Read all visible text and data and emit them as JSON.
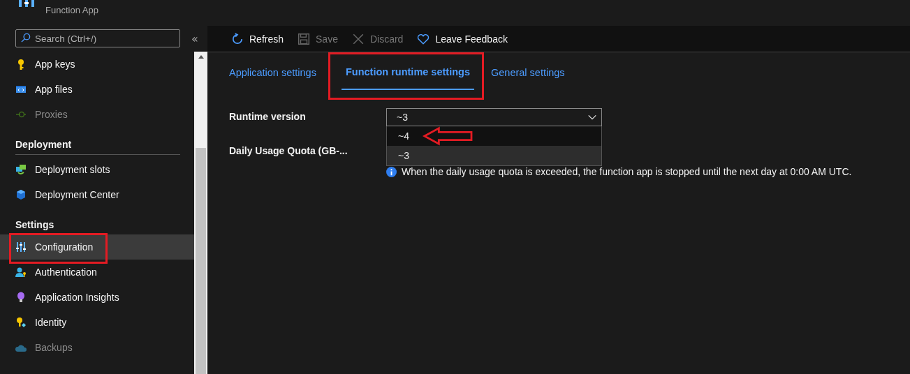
{
  "header": {
    "subtitle": "Function App"
  },
  "sidebar": {
    "search": {
      "placeholder": "Search (Ctrl+/)"
    },
    "collapse": "«",
    "items": [
      {
        "kind": "item",
        "label": "App keys",
        "disabled": false,
        "selected": false,
        "highlighted": false
      },
      {
        "kind": "item",
        "label": "App files",
        "disabled": false,
        "selected": false,
        "highlighted": false
      },
      {
        "kind": "item",
        "label": "Proxies",
        "disabled": true,
        "selected": false,
        "highlighted": false
      },
      {
        "kind": "section",
        "label": "Deployment"
      },
      {
        "kind": "item",
        "label": "Deployment slots",
        "disabled": false,
        "selected": false,
        "highlighted": false
      },
      {
        "kind": "item",
        "label": "Deployment Center",
        "disabled": false,
        "selected": false,
        "highlighted": false
      },
      {
        "kind": "section",
        "label": "Settings"
      },
      {
        "kind": "item",
        "label": "Configuration",
        "disabled": false,
        "selected": true,
        "highlighted": true
      },
      {
        "kind": "item",
        "label": "Authentication",
        "disabled": false,
        "selected": false,
        "highlighted": false
      },
      {
        "kind": "item",
        "label": "Application Insights",
        "disabled": false,
        "selected": false,
        "highlighted": false
      },
      {
        "kind": "item",
        "label": "Identity",
        "disabled": false,
        "selected": false,
        "highlighted": false
      },
      {
        "kind": "item",
        "label": "Backups",
        "disabled": true,
        "selected": false,
        "highlighted": false
      }
    ]
  },
  "toolbar": [
    {
      "label": "Refresh",
      "disabled": false
    },
    {
      "label": "Save",
      "disabled": true
    },
    {
      "label": "Discard",
      "disabled": true
    },
    {
      "label": "Leave Feedback",
      "disabled": false
    }
  ],
  "tabs": [
    {
      "label": "Application settings",
      "selected": false,
      "highlighted": false
    },
    {
      "label": "Function runtime settings",
      "selected": true,
      "highlighted": true
    },
    {
      "label": "General settings",
      "selected": false,
      "highlighted": false
    }
  ],
  "form": {
    "runtime_label": "Runtime version",
    "runtime_value": "~3",
    "options": [
      {
        "label": "~4",
        "selected": false,
        "pointed": true
      },
      {
        "label": "~3",
        "selected": true,
        "pointed": false
      }
    ],
    "quota_label": "Daily Usage Quota (GB-...",
    "info": "When the daily usage quota is exceeded, the function app is stopped until the next day at 0:00 AM UTC."
  }
}
